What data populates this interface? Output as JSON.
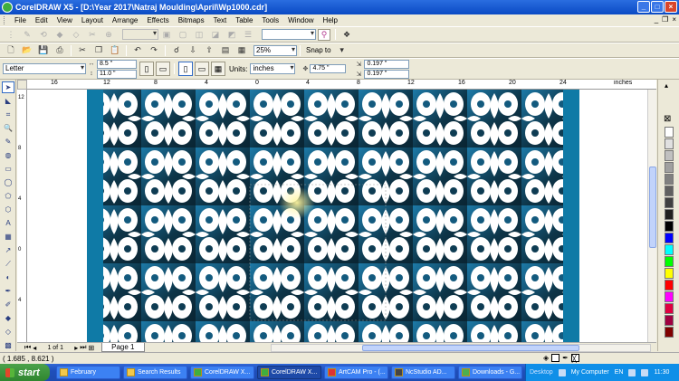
{
  "window": {
    "title": "CorelDRAW X5 - [D:\\Year 2017\\Natraj Moulding\\April\\Wp1000.cdr]"
  },
  "menu": {
    "items": [
      "File",
      "Edit",
      "View",
      "Layout",
      "Arrange",
      "Effects",
      "Bitmaps",
      "Text",
      "Table",
      "Tools",
      "Window",
      "Help"
    ]
  },
  "toolbar2": {
    "zoom": "25%",
    "snap_to": "Snap to"
  },
  "property_bar": {
    "page_size": "Letter",
    "width": "8.5 \"",
    "height": "11.0 \"",
    "units_label": "Units:",
    "units": "inches",
    "nudge": "4.75 \"",
    "dup_x": "0.197 \"",
    "dup_y": "0.197 \""
  },
  "ruler": {
    "units_label": "inches",
    "h_ticks": [
      "16",
      "12",
      "8",
      "4",
      "0",
      "4",
      "8",
      "12",
      "16",
      "20",
      "24"
    ],
    "v_ticks": [
      "12",
      "8",
      "4",
      "0",
      "4"
    ]
  },
  "pager": {
    "count": "1 of 1",
    "tab": "Page 1"
  },
  "status": {
    "coords": "( 1.685 , 8.621 )"
  },
  "taskbar": {
    "start": "start",
    "tasks": [
      "February",
      "Search Results",
      "CorelDRAW X...",
      "CorelDRAW X...",
      "ArtCAM Pro - (...",
      "NcStudio AD...",
      "Downloads - G..."
    ],
    "tray": {
      "desktop": "Desktop",
      "my_computer": "My Computer",
      "lang": "EN",
      "time": "11:30"
    }
  },
  "colors": {
    "pattern_blue": "#1a6f9b",
    "pattern_dark": "#0c2b3a",
    "panel_blue": "#0f7aa6",
    "title_blue": "#0a4ac4"
  },
  "palette": [
    "#ffffff",
    "#e0e0e0",
    "#c0c0c0",
    "#a0a0a0",
    "#808080",
    "#606060",
    "#404040",
    "#202020",
    "#000000",
    "#0000ff",
    "#00ffff",
    "#00ff00",
    "#ffff00",
    "#ff0000",
    "#ff00ff",
    "#e00040",
    "#a00040",
    "#800000"
  ]
}
